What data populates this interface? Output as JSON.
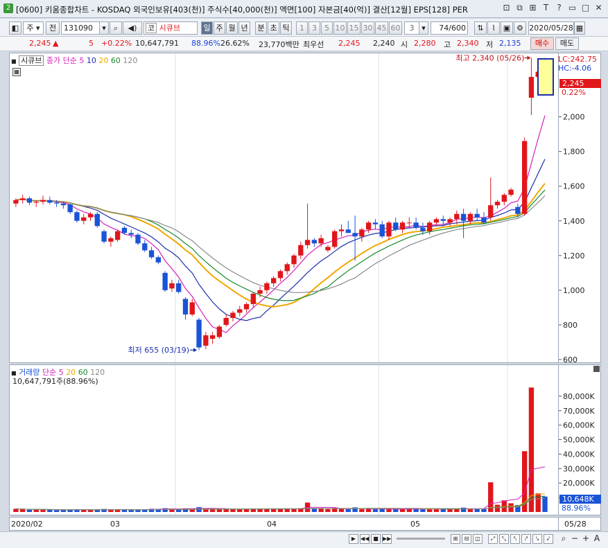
{
  "window": {
    "badge": "2",
    "title": "[0600] 키움종합차트 - KOSDAQ 외국인보유[403(천)] 주식수[40,000(천)] 액면[100] 자본금[40(억)] 결산[12월] EPS[128] PER",
    "icons": [
      "restore-icon",
      "tile-icon",
      "pin-icon",
      "help-icon",
      "minimize-icon",
      "maximize-icon",
      "close-icon"
    ]
  },
  "toolbar": {
    "period_type": "주",
    "prev_label": "전",
    "code": "131090",
    "market_prefix": "코",
    "stock_name": "시큐브",
    "intervals": [
      "일",
      "주",
      "월",
      "년",
      "분",
      "초",
      "틱"
    ],
    "selected_interval": "일",
    "minute_options": [
      "1",
      "3",
      "5",
      "10",
      "15",
      "30",
      "45",
      "60"
    ],
    "tick_value": "3",
    "count_display": "74",
    "count_total": "/600",
    "date": "2020/05/28"
  },
  "quote": {
    "price": "2,245",
    "change": "5",
    "change_pct": "+0.22%",
    "volume": "10,647,791",
    "vol_ratio": "88.96%",
    "turnover": "26.62%",
    "amount": "23,770백만",
    "priority_label": "최우선",
    "ask": "2,245",
    "bid": "2,240",
    "open_label": "시",
    "open": "2,280",
    "high_label": "고",
    "high": "2,340",
    "low_label": "저",
    "low": "2,135",
    "buy_label": "매수",
    "sell_label": "매도"
  },
  "price_pane": {
    "legend_name": "시큐브",
    "legend_ma_label": "종가 단순",
    "ma_periods": [
      "5",
      "10",
      "20",
      "60",
      "120"
    ],
    "ma_colors": [
      "#d41fbb",
      "#1c2ea8",
      "#f0a800",
      "#19892e",
      "#888888"
    ],
    "lc_label": "LC:242.75",
    "hc_label": "HC:-4.06",
    "last_price_tag": "2,245",
    "last_pct_tag": "0.22%",
    "high_annotation": "최고 2,340 (05/26)",
    "low_annotation": "최저 655 (03/19)",
    "y_ticks": [
      "2,000",
      "1,800",
      "1,600",
      "1,400",
      "1,200",
      "1,000",
      "800",
      "600"
    ]
  },
  "volume_pane": {
    "legend_name": "거래량",
    "legend_ma_label": "단순",
    "ma_periods": [
      "5",
      "20",
      "60",
      "120"
    ],
    "summary": "10,647,791주(88.96%)",
    "last_vol_tag": "10,648K",
    "last_pct_tag": "88.96%",
    "y_ticks": [
      "80,000K",
      "70,000K",
      "60,000K",
      "50,000K",
      "40,000K",
      "30,000K",
      "20,000K",
      "10,000K"
    ]
  },
  "x_axis": {
    "labels": [
      "2020/02",
      "03",
      "04",
      "05"
    ],
    "right_label": "05/28"
  },
  "colors": {
    "up": "#e0161b",
    "down": "#1a54d6",
    "highlight_box": "#ffff99"
  },
  "chart_data": {
    "type": "candlestick",
    "price_ylim": [
      600,
      2350
    ],
    "volume_ylim_k": [
      0,
      90000
    ],
    "dates_note": "daily candles from 2020/02 to 2020/05/28",
    "candles": [
      {
        "o": 1500,
        "h": 1530,
        "l": 1480,
        "c": 1520
      },
      {
        "o": 1520,
        "h": 1550,
        "l": 1500,
        "c": 1530
      },
      {
        "o": 1530,
        "h": 1540,
        "l": 1490,
        "c": 1505
      },
      {
        "o": 1505,
        "h": 1520,
        "l": 1480,
        "c": 1510
      },
      {
        "o": 1510,
        "h": 1545,
        "l": 1495,
        "c": 1520
      },
      {
        "o": 1520,
        "h": 1540,
        "l": 1495,
        "c": 1505
      },
      {
        "o": 1505,
        "h": 1520,
        "l": 1480,
        "c": 1500
      },
      {
        "o": 1500,
        "h": 1510,
        "l": 1470,
        "c": 1490
      },
      {
        "o": 1495,
        "h": 1500,
        "l": 1440,
        "c": 1450
      },
      {
        "o": 1450,
        "h": 1460,
        "l": 1390,
        "c": 1400
      },
      {
        "o": 1400,
        "h": 1440,
        "l": 1380,
        "c": 1420
      },
      {
        "o": 1420,
        "h": 1450,
        "l": 1400,
        "c": 1440
      },
      {
        "o": 1440,
        "h": 1450,
        "l": 1360,
        "c": 1370
      },
      {
        "o": 1340,
        "h": 1350,
        "l": 1270,
        "c": 1280
      },
      {
        "o": 1280,
        "h": 1310,
        "l": 1250,
        "c": 1300
      },
      {
        "o": 1290,
        "h": 1350,
        "l": 1280,
        "c": 1340
      },
      {
        "o": 1360,
        "h": 1370,
        "l": 1320,
        "c": 1330
      },
      {
        "o": 1330,
        "h": 1350,
        "l": 1300,
        "c": 1320
      },
      {
        "o": 1320,
        "h": 1330,
        "l": 1260,
        "c": 1270
      },
      {
        "o": 1270,
        "h": 1290,
        "l": 1220,
        "c": 1230
      },
      {
        "o": 1230,
        "h": 1250,
        "l": 1180,
        "c": 1190
      },
      {
        "o": 1190,
        "h": 1200,
        "l": 1150,
        "c": 1160
      },
      {
        "o": 1100,
        "h": 1110,
        "l": 990,
        "c": 1000
      },
      {
        "o": 1010,
        "h": 1060,
        "l": 990,
        "c": 1040
      },
      {
        "o": 1040,
        "h": 1060,
        "l": 980,
        "c": 990
      },
      {
        "o": 950,
        "h": 960,
        "l": 830,
        "c": 860
      },
      {
        "o": 860,
        "h": 950,
        "l": 850,
        "c": 930
      },
      {
        "o": 830,
        "h": 840,
        "l": 655,
        "c": 670
      },
      {
        "o": 680,
        "h": 760,
        "l": 660,
        "c": 740
      },
      {
        "o": 720,
        "h": 760,
        "l": 690,
        "c": 740
      },
      {
        "o": 730,
        "h": 800,
        "l": 720,
        "c": 790
      },
      {
        "o": 800,
        "h": 860,
        "l": 790,
        "c": 840
      },
      {
        "o": 840,
        "h": 880,
        "l": 820,
        "c": 870
      },
      {
        "o": 870,
        "h": 910,
        "l": 850,
        "c": 890
      },
      {
        "o": 890,
        "h": 930,
        "l": 870,
        "c": 920
      },
      {
        "o": 920,
        "h": 990,
        "l": 900,
        "c": 980
      },
      {
        "o": 980,
        "h": 1020,
        "l": 960,
        "c": 1000
      },
      {
        "o": 1000,
        "h": 1050,
        "l": 980,
        "c": 1040
      },
      {
        "o": 1040,
        "h": 1080,
        "l": 1020,
        "c": 1070
      },
      {
        "o": 1070,
        "h": 1120,
        "l": 1050,
        "c": 1110
      },
      {
        "o": 1110,
        "h": 1160,
        "l": 1090,
        "c": 1150
      },
      {
        "o": 1150,
        "h": 1210,
        "l": 1130,
        "c": 1200
      },
      {
        "o": 1200,
        "h": 1280,
        "l": 1180,
        "c": 1260
      },
      {
        "o": 1260,
        "h": 1500,
        "l": 1240,
        "c": 1290
      },
      {
        "o": 1290,
        "h": 1300,
        "l": 1250,
        "c": 1270
      },
      {
        "o": 1270,
        "h": 1320,
        "l": 1250,
        "c": 1300
      },
      {
        "o": 1230,
        "h": 1260,
        "l": 1220,
        "c": 1250
      },
      {
        "o": 1250,
        "h": 1350,
        "l": 1240,
        "c": 1340
      },
      {
        "o": 1340,
        "h": 1380,
        "l": 1310,
        "c": 1350
      },
      {
        "o": 1350,
        "h": 1400,
        "l": 1330,
        "c": 1330
      },
      {
        "o": 1330,
        "h": 1430,
        "l": 1170,
        "c": 1310
      },
      {
        "o": 1310,
        "h": 1360,
        "l": 1280,
        "c": 1350
      },
      {
        "o": 1350,
        "h": 1400,
        "l": 1330,
        "c": 1390
      },
      {
        "o": 1390,
        "h": 1410,
        "l": 1350,
        "c": 1380
      },
      {
        "o": 1380,
        "h": 1400,
        "l": 1300,
        "c": 1310
      },
      {
        "o": 1310,
        "h": 1400,
        "l": 1290,
        "c": 1390
      },
      {
        "o": 1390,
        "h": 1420,
        "l": 1340,
        "c": 1350
      },
      {
        "o": 1350,
        "h": 1400,
        "l": 1330,
        "c": 1390
      },
      {
        "o": 1390,
        "h": 1420,
        "l": 1360,
        "c": 1390
      },
      {
        "o": 1390,
        "h": 1420,
        "l": 1350,
        "c": 1360
      },
      {
        "o": 1360,
        "h": 1390,
        "l": 1320,
        "c": 1340
      },
      {
        "o": 1340,
        "h": 1400,
        "l": 1320,
        "c": 1390
      },
      {
        "o": 1390,
        "h": 1420,
        "l": 1370,
        "c": 1410
      },
      {
        "o": 1410,
        "h": 1430,
        "l": 1370,
        "c": 1400
      },
      {
        "o": 1390,
        "h": 1420,
        "l": 1370,
        "c": 1410
      },
      {
        "o": 1410,
        "h": 1460,
        "l": 1380,
        "c": 1440
      },
      {
        "o": 1440,
        "h": 1470,
        "l": 1300,
        "c": 1400
      },
      {
        "o": 1400,
        "h": 1450,
        "l": 1380,
        "c": 1440
      },
      {
        "o": 1440,
        "h": 1470,
        "l": 1400,
        "c": 1420
      },
      {
        "o": 1420,
        "h": 1450,
        "l": 1380,
        "c": 1390
      },
      {
        "o": 1420,
        "h": 1650,
        "l": 1400,
        "c": 1490
      },
      {
        "o": 1490,
        "h": 1520,
        "l": 1470,
        "c": 1510
      },
      {
        "o": 1510,
        "h": 1560,
        "l": 1490,
        "c": 1550
      },
      {
        "o": 1550,
        "h": 1590,
        "l": 1540,
        "c": 1580
      },
      {
        "o": 1480,
        "h": 1500,
        "l": 1420,
        "c": 1440
      },
      {
        "o": 1440,
        "h": 1880,
        "l": 1430,
        "c": 1860
      },
      {
        "o": 2110,
        "h": 2340,
        "l": 2010,
        "c": 2230
      },
      {
        "o": 2230,
        "h": 2310,
        "l": 2140,
        "c": 2260
      },
      {
        "o": 2280,
        "h": 2340,
        "l": 2135,
        "c": 2245
      }
    ],
    "volume_k": [
      2200,
      1800,
      1500,
      1600,
      1700,
      1500,
      1300,
      1200,
      1600,
      1800,
      1500,
      1400,
      1700,
      2100,
      1600,
      1800,
      1500,
      1400,
      1800,
      1900,
      2200,
      2100,
      2600,
      1900,
      1800,
      2500,
      2400,
      3300,
      2200,
      2100,
      1900,
      2000,
      1800,
      1900,
      2000,
      2400,
      2300,
      2200,
      2000,
      2100,
      2300,
      2400,
      2600,
      6500,
      2400,
      2200,
      2000,
      2800,
      2100,
      1900,
      3200,
      2000,
      2100,
      1900,
      2000,
      2100,
      1800,
      1900,
      2200,
      2000,
      1900,
      2000,
      2100,
      1900,
      2000,
      2400,
      3000,
      2200,
      2000,
      2100,
      20500,
      5000,
      8000,
      6000,
      4800,
      42000,
      86000,
      12800,
      10648
    ],
    "series_ma_price": [
      {
        "name": "5"
      },
      {
        "name": "10"
      },
      {
        "name": "20"
      },
      {
        "name": "60"
      },
      {
        "name": "120"
      }
    ]
  }
}
